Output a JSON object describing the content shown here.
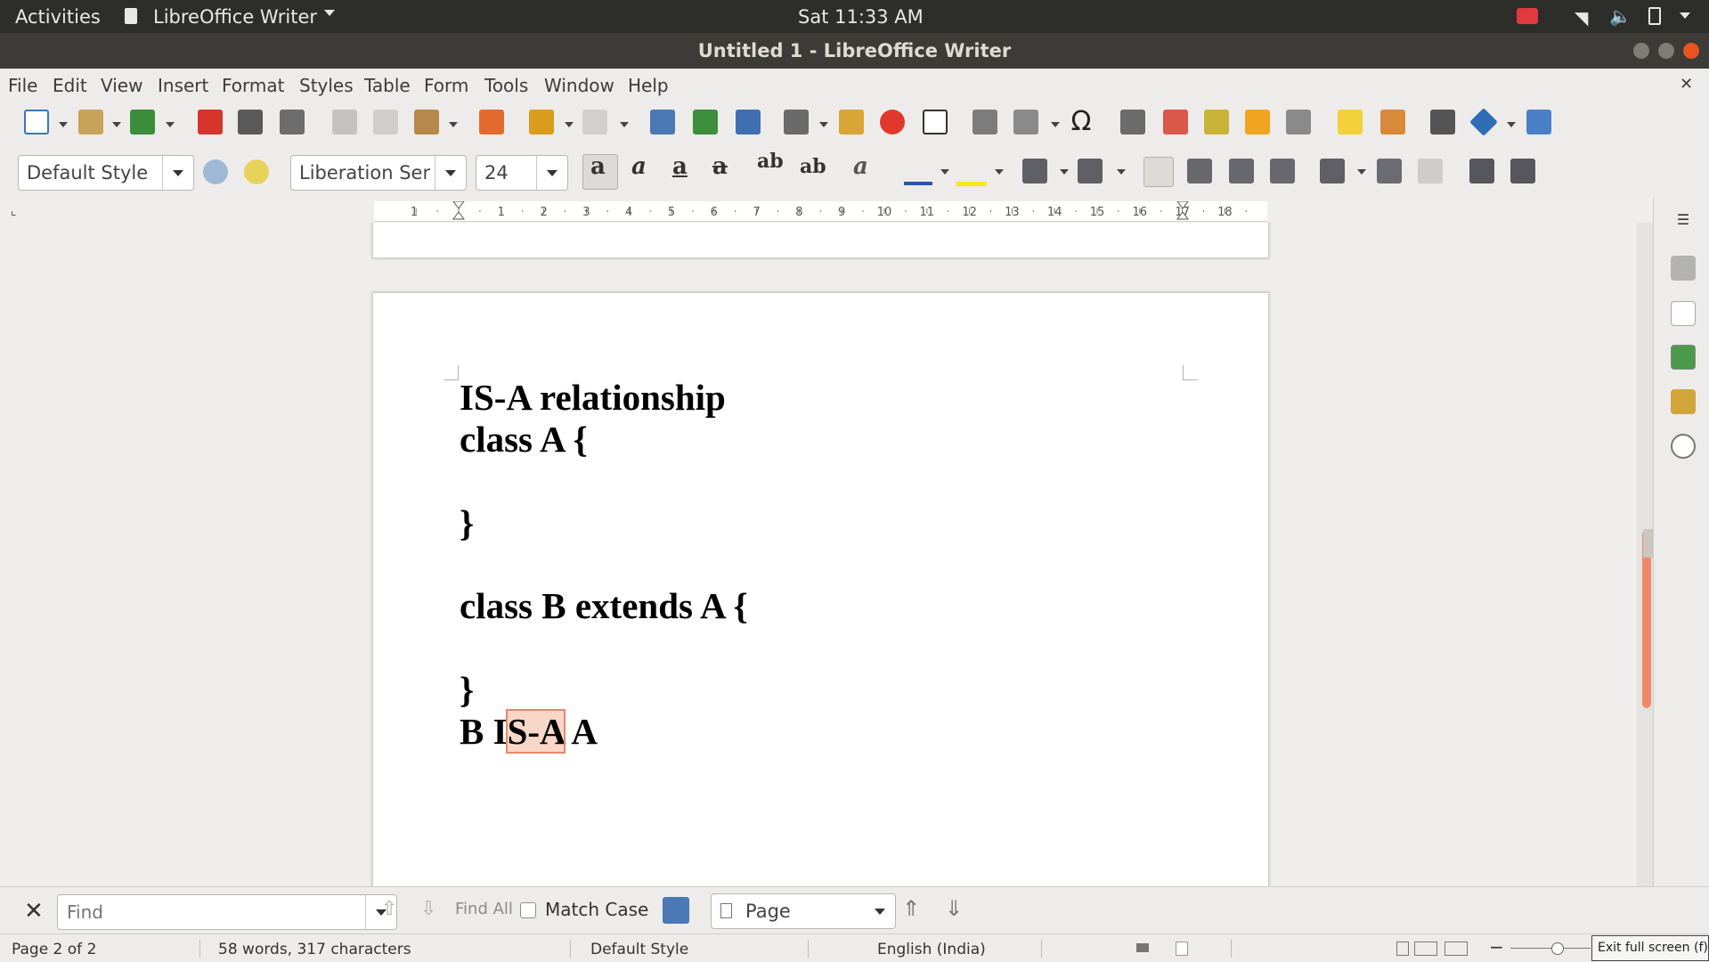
{
  "topbar": {
    "activities": "Activities",
    "app_name": "LibreOffice Writer",
    "clock": "Sat 11:33 AM"
  },
  "window": {
    "title": "Untitled 1 - LibreOffice Writer"
  },
  "menu": [
    "File",
    "Edit",
    "View",
    "Insert",
    "Format",
    "Styles",
    "Table",
    "Form",
    "Tools",
    "Window",
    "Help"
  ],
  "formatting": {
    "paragraph_style": "Default Style",
    "font_name": "Liberation Serif",
    "font_size": "24"
  },
  "ruler_numbers": [
    "1",
    "1",
    "2",
    "3",
    "4",
    "5",
    "6",
    "7",
    "8",
    "9",
    "10",
    "11",
    "12",
    "13",
    "14",
    "15",
    "16",
    "17",
    "18"
  ],
  "document": {
    "lines": [
      "IS-A relationship",
      "class A {",
      "",
      "}",
      "",
      "class B extends A {",
      "",
      "}"
    ],
    "last_line": {
      "before": "B I",
      "highlight": "S-A",
      "after": " A"
    }
  },
  "findbar": {
    "placeholder": "Find",
    "find_all": "Find All",
    "match_case": "Match Case",
    "search_type": "Page"
  },
  "status": {
    "page": "Page 2 of 2",
    "words": "58 words, 317 characters",
    "style": "Default Style",
    "language": "English (India)"
  },
  "tooltip": "Exit full screen (f)",
  "colors": {
    "topbar": "#2d2d2a",
    "titlebar": "#3c3b37",
    "highlight": "#f8d7c9",
    "close_button": "#e9541f",
    "scroll_thumb": "#f0896a"
  }
}
